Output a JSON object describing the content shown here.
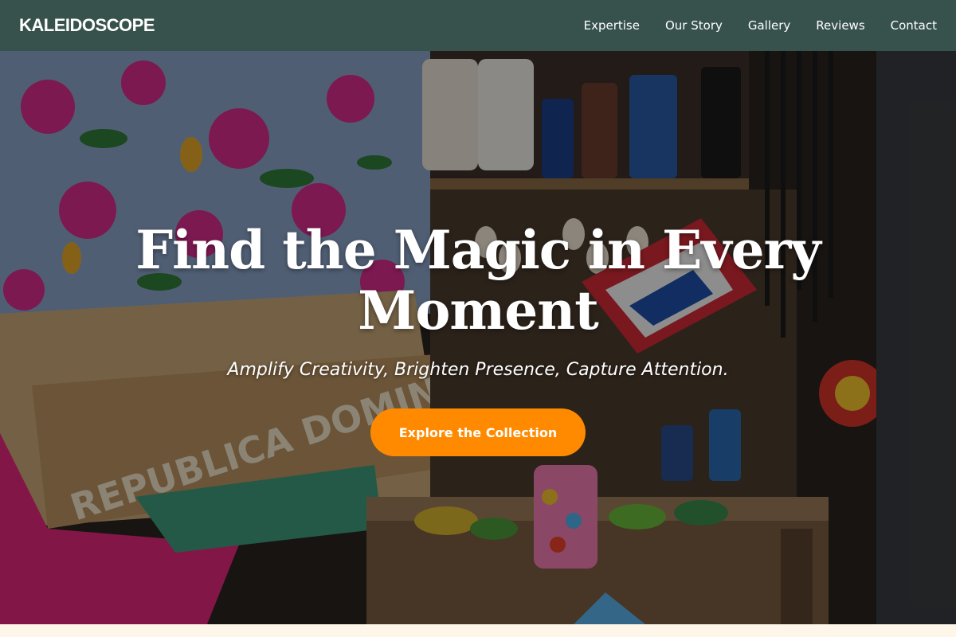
{
  "brand": {
    "name": "KALEIDOSCOPE"
  },
  "nav": {
    "items": [
      {
        "label": "Expertise"
      },
      {
        "label": "Our Story"
      },
      {
        "label": "Gallery"
      },
      {
        "label": "Reviews"
      },
      {
        "label": "Contact"
      }
    ]
  },
  "hero": {
    "title": "Find the Magic in Every Moment",
    "subtitle": "Amplify Creativity, Brighten Presence, Capture Attention.",
    "cta_label": "Explore the Collection",
    "background_image": "market-stall-photo",
    "banner_text": "REPUBLICA DOMINICANA"
  },
  "colors": {
    "nav_bg": "#37524d",
    "accent": "#ff8a00",
    "page_bg": "#fdf6e9"
  }
}
